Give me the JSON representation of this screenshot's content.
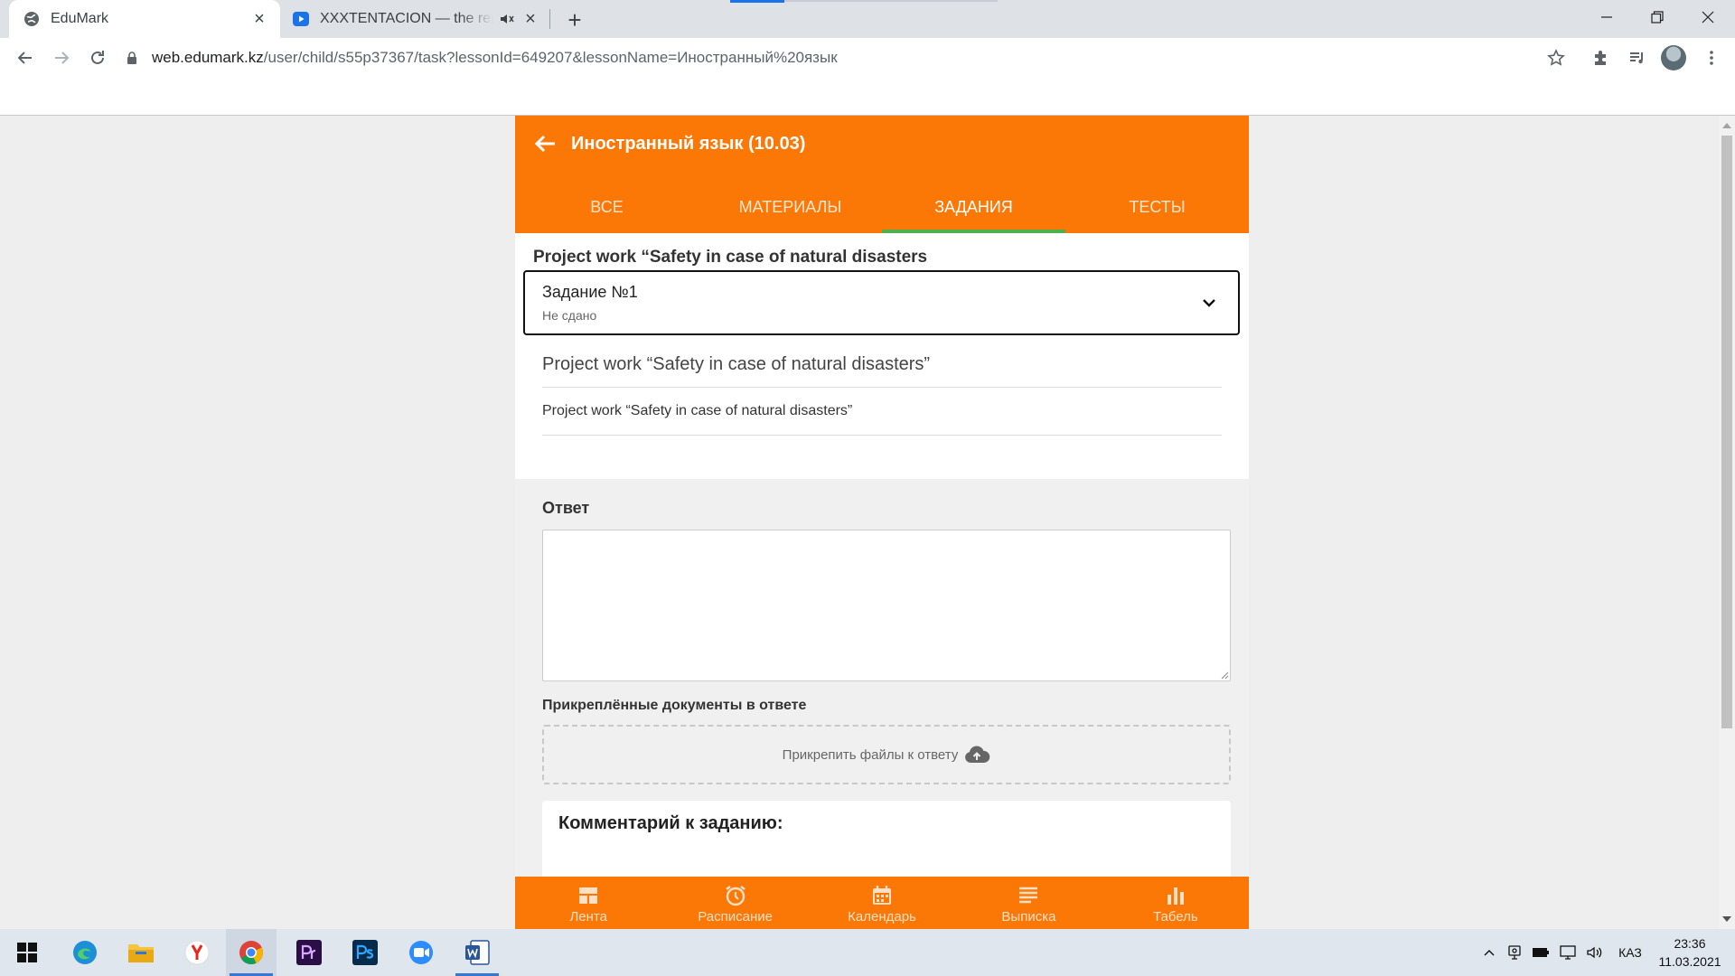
{
  "browser": {
    "tabs": [
      {
        "title": "EduMark",
        "active": true
      },
      {
        "title": "XXXTENTACION — the reme",
        "active": false,
        "audio": true
      }
    ],
    "url_host": "web.edumark.kz",
    "url_path": "/user/child/s55p37367/task?lessonId=649207&lessonName=Иностранный%20язык"
  },
  "header": {
    "lesson_title": "Иностранный язык (10.03)",
    "tabs": [
      {
        "label": "Все",
        "active": false
      },
      {
        "label": "Материалы",
        "active": false
      },
      {
        "label": "Задания",
        "active": true
      },
      {
        "label": "Тесты",
        "active": false
      }
    ]
  },
  "task": {
    "heading": "Project work “Safety in case of natural disasters",
    "select_name": "Задание №1",
    "select_status": "Не сдано",
    "description_title": "Project work “Safety in case of natural disasters”",
    "description_text": "Project work “Safety in case of natural disasters”"
  },
  "answer": {
    "label": "Ответ",
    "value": "",
    "attached_label": "Прикреплённые документы в ответе",
    "attach_button": "Прикрепить файлы к ответу",
    "comment_title": "Комментарий к заданию:"
  },
  "bottom_nav": [
    {
      "label": "Лента",
      "icon": "feed-icon"
    },
    {
      "label": "Расписание",
      "icon": "alarm-clock-icon"
    },
    {
      "label": "Календарь",
      "icon": "calendar-icon"
    },
    {
      "label": "Выписка",
      "icon": "list-icon"
    },
    {
      "label": "Табель",
      "icon": "bar-chart-icon"
    }
  ],
  "taskbar": {
    "language": "КАЗ",
    "time": "23:36",
    "date": "11.03.2021"
  },
  "colors": {
    "brand_orange": "#fb7807",
    "tab_indicator": "#4caf50",
    "taskbar_indicator": "#3578d4"
  }
}
